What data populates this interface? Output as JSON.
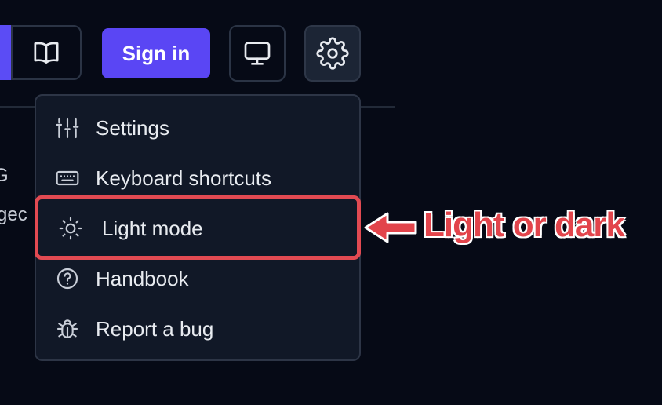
{
  "toolbar": {
    "signin_label": "Sign in",
    "docs_icon": "book-open-icon",
    "monitor_icon": "monitor-icon",
    "settings_icon": "gear-icon"
  },
  "background": {
    "fragment_1": "G",
    "fragment_2": "gec"
  },
  "menu": {
    "items": [
      {
        "label": "Settings",
        "icon": "sliders-icon"
      },
      {
        "label": "Keyboard shortcuts",
        "icon": "keyboard-icon"
      },
      {
        "label": "Light mode",
        "icon": "sun-icon"
      },
      {
        "label": "Handbook",
        "icon": "help-circle-icon"
      },
      {
        "label": "Report a bug",
        "icon": "bug-icon"
      }
    ]
  },
  "annotation": {
    "callout_text": "Light or dark",
    "color": "#e2444b"
  },
  "colors": {
    "background": "#060a16",
    "menu_bg": "#111827",
    "accent": "#5a46f4"
  }
}
